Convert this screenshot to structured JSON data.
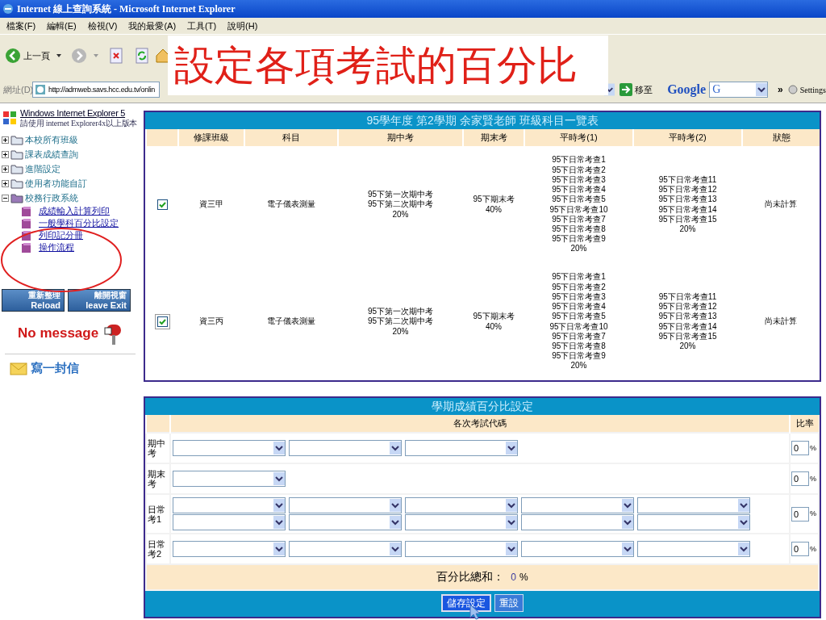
{
  "window": {
    "title": "Internet 線上查詢系統 - Microsoft Internet Explorer"
  },
  "menu": [
    "檔案(F)",
    "編輯(E)",
    "檢視(V)",
    "我的最愛(A)",
    "工具(T)",
    "說明(H)"
  ],
  "toolbar": {
    "back_label": "上一頁"
  },
  "address_bar": {
    "label": "網址(D)",
    "url": "http://admweb.savs.hcc.edu.tv/onlin",
    "go_label": "移至",
    "search_logo": "Google",
    "search_value": "G",
    "more": "»",
    "settings": "Settings"
  },
  "slide_title": "設定各項考試的百分比",
  "sidebar": {
    "banner_title": "Windows Internet Explorer 5",
    "banner_subtitle": "請使用 internet Explorer4x以上版本",
    "items": [
      {
        "label": "本校所有班級",
        "expanded": false
      },
      {
        "label": "課表成績查詢",
        "expanded": false
      },
      {
        "label": "進階設定",
        "expanded": false
      },
      {
        "label": "使用者功能自訂",
        "expanded": false
      },
      {
        "label": "校務行政系統",
        "expanded": true,
        "children": [
          {
            "label": "成績輸入計算列印"
          },
          {
            "label": "一般學科百分比設定"
          },
          {
            "label": "列印記分冊"
          },
          {
            "label": "操作流程"
          }
        ]
      }
    ],
    "buttons": [
      {
        "label": "重新整理",
        "sublabel": "Reload"
      },
      {
        "label": "離開視窗",
        "sublabel": "leave Exit"
      }
    ],
    "message": "No message",
    "mail_link": "寫一封信"
  },
  "class_table": {
    "title": "95學年度 第2學期 余家賢老師 班級科目一覽表",
    "columns": [
      "修課班級",
      "科目",
      "期中考",
      "期末考",
      "平時考(1)",
      "平時考(2)",
      "狀態"
    ],
    "rows": [
      {
        "checked": true,
        "focused": false,
        "class": "資三甲",
        "subject": "電子儀表測量",
        "midterm": [
          "95下第一次期中考",
          "95下第二次期中考",
          "20%"
        ],
        "final": [
          "95下期末考",
          "40%"
        ],
        "quiz1": [
          "95下日常考查1",
          "95下日常考查2",
          "95下日常考查3",
          "95下日常考查4",
          "95下日常考查5",
          "95下日常考查10",
          "95下日常考查7",
          "95下日常考查8",
          "95下日常考查9",
          "20%"
        ],
        "quiz2": [
          "95下日常考查11",
          "95下日常考查12",
          "95下日常考查13",
          "95下日常考查14",
          "95下日常考查15",
          "20%"
        ],
        "status": "尚未計算"
      },
      {
        "checked": true,
        "focused": true,
        "class": "資三丙",
        "subject": "電子儀表測量",
        "midterm": [
          "95下第一次期中考",
          "95下第二次期中考",
          "20%"
        ],
        "final": [
          "95下期末考",
          "40%"
        ],
        "quiz1": [
          "95下日常考查1",
          "95下日常考查2",
          "95下日常考查3",
          "95下日常考查4",
          "95下日常考查5",
          "95下日常考查10",
          "95下日常考查7",
          "95下日常考查8",
          "95下日常考查9",
          "20%"
        ],
        "quiz2": [
          "95下日常考查11",
          "95下日常考查12",
          "95下日常考查13",
          "95下日常考查14",
          "95下日常考查15",
          "20%"
        ],
        "status": "尚未計算"
      }
    ]
  },
  "percent_settings": {
    "title": "學期成績百分比設定",
    "code_header": "各次考試代碼",
    "ratio_header": "比率",
    "rows": [
      {
        "label": "期中考",
        "lines": [
          [
            {
              "kind": "dropdown"
            },
            {
              "kind": "dropdown"
            },
            {
              "kind": "dropdown"
            }
          ]
        ],
        "ratio": "0",
        "unit": "%"
      },
      {
        "label": "期末考",
        "lines": [
          [
            {
              "kind": "dropdown"
            }
          ]
        ],
        "ratio": "0",
        "unit": "%"
      },
      {
        "label": "日常考1",
        "lines": [
          [
            {
              "kind": "dropdown"
            },
            {
              "kind": "dropdown"
            },
            {
              "kind": "dropdown"
            },
            {
              "kind": "dropdown"
            },
            {
              "kind": "dropdown"
            }
          ],
          [
            {
              "kind": "dropdown"
            },
            {
              "kind": "dropdown"
            },
            {
              "kind": "dropdown"
            },
            {
              "kind": "dropdown"
            },
            {
              "kind": "dropdown"
            }
          ]
        ],
        "ratio": "0",
        "unit": "%"
      },
      {
        "label": "日常考2",
        "lines": [
          [
            {
              "kind": "dropdown"
            },
            {
              "kind": "dropdown"
            },
            {
              "kind": "dropdown"
            },
            {
              "kind": "dropdown"
            },
            {
              "kind": "dropdown"
            }
          ]
        ],
        "ratio": "0",
        "unit": "%"
      }
    ],
    "total_label": "百分比總和：",
    "total_value": "0",
    "total_unit": "%",
    "buttons": [
      {
        "label": "儲存設定",
        "primary": true
      },
      {
        "label": "重設",
        "primary": false
      }
    ]
  }
}
